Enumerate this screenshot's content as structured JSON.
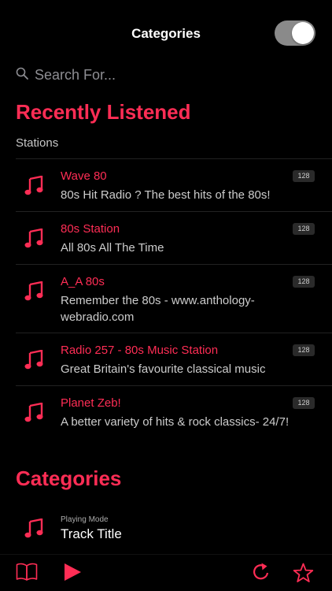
{
  "header": {
    "title": "Categories"
  },
  "search": {
    "placeholder": "Search For..."
  },
  "recent": {
    "title": "Recently Listened",
    "subtitle": "Stations",
    "stations": [
      {
        "name": "Wave 80",
        "desc": "80s Hit Radio ? The best hits of the 80s!",
        "bitrate": "128"
      },
      {
        "name": "80s Station",
        "desc": "All 80s All The Time",
        "bitrate": "128"
      },
      {
        "name": "A_A 80s",
        "desc": "Remember the 80s - www.anthology-webradio.com",
        "bitrate": "128"
      },
      {
        "name": "Radio 257 - 80s Music Station",
        "desc": "Great Britain's favourite classical music",
        "bitrate": "128"
      },
      {
        "name": "Planet Zeb!",
        "desc": "A better variety of hits & rock classics- 24/7!",
        "bitrate": "128"
      }
    ]
  },
  "categories": {
    "title": "Categories",
    "now_playing": {
      "mode": "Playing Mode",
      "track": "Track Title"
    }
  },
  "toggle": {
    "on": true
  },
  "colors": {
    "accent": "#ff2d55",
    "background": "#000000"
  },
  "tabbar": {
    "icons": [
      "book-icon",
      "play-icon",
      "refresh-icon",
      "star-icon"
    ]
  }
}
